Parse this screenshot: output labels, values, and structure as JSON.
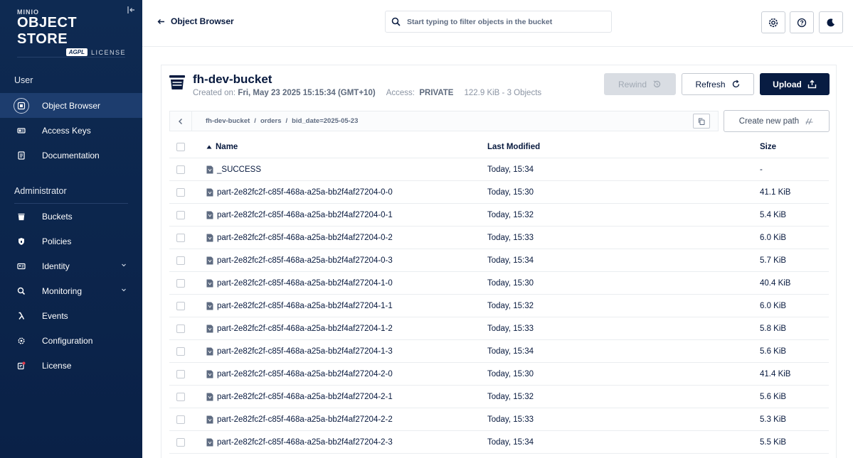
{
  "brand": {
    "minio": "MINIO",
    "title": "OBJECT STORE",
    "agpl": "AGPL",
    "license": "LICENSE"
  },
  "sidebar": {
    "user_section": "User",
    "admin_section": "Administrator",
    "user_items": [
      {
        "label": "Object Browser",
        "icon": "object-browser-icon",
        "active": true
      },
      {
        "label": "Access Keys",
        "icon": "access-keys-icon"
      },
      {
        "label": "Documentation",
        "icon": "documentation-icon"
      }
    ],
    "admin_items": [
      {
        "label": "Buckets",
        "icon": "buckets-icon"
      },
      {
        "label": "Policies",
        "icon": "policies-icon"
      },
      {
        "label": "Identity",
        "icon": "identity-icon",
        "expandable": true
      },
      {
        "label": "Monitoring",
        "icon": "monitoring-icon",
        "expandable": true
      },
      {
        "label": "Events",
        "icon": "lambda-icon"
      },
      {
        "label": "Configuration",
        "icon": "gear-icon"
      },
      {
        "label": "License",
        "icon": "license-icon"
      }
    ]
  },
  "topbar": {
    "back_label": "Object Browser",
    "search_placeholder": "Start typing to filter objects in the bucket"
  },
  "bucket": {
    "name": "fh-dev-bucket",
    "created_label": "Created on:",
    "created_value": "Fri, May 23 2025 15:15:34 (GMT+10)",
    "access_label": "Access:",
    "access_value": "PRIVATE",
    "size_summary": "122.9 KiB - 3 Objects"
  },
  "actions": {
    "rewind": "Rewind",
    "refresh": "Refresh",
    "upload": "Upload",
    "create_path": "Create new path"
  },
  "breadcrumb": [
    "fh-dev-bucket",
    "orders",
    "bid_date=2025-05-23"
  ],
  "table": {
    "headers": {
      "name": "Name",
      "modified": "Last Modified",
      "size": "Size"
    },
    "rows": [
      {
        "name": "_SUCCESS",
        "modified": "Today, 15:34",
        "size": "-"
      },
      {
        "name": "part-2e82fc2f-c85f-468a-a25a-bb2f4af27204-0-0",
        "modified": "Today, 15:30",
        "size": "41.1 KiB"
      },
      {
        "name": "part-2e82fc2f-c85f-468a-a25a-bb2f4af27204-0-1",
        "modified": "Today, 15:32",
        "size": "5.4 KiB"
      },
      {
        "name": "part-2e82fc2f-c85f-468a-a25a-bb2f4af27204-0-2",
        "modified": "Today, 15:33",
        "size": "6.0 KiB"
      },
      {
        "name": "part-2e82fc2f-c85f-468a-a25a-bb2f4af27204-0-3",
        "modified": "Today, 15:34",
        "size": "5.7 KiB"
      },
      {
        "name": "part-2e82fc2f-c85f-468a-a25a-bb2f4af27204-1-0",
        "modified": "Today, 15:30",
        "size": "40.4 KiB"
      },
      {
        "name": "part-2e82fc2f-c85f-468a-a25a-bb2f4af27204-1-1",
        "modified": "Today, 15:32",
        "size": "6.0 KiB"
      },
      {
        "name": "part-2e82fc2f-c85f-468a-a25a-bb2f4af27204-1-2",
        "modified": "Today, 15:33",
        "size": "5.8 KiB"
      },
      {
        "name": "part-2e82fc2f-c85f-468a-a25a-bb2f4af27204-1-3",
        "modified": "Today, 15:34",
        "size": "5.6 KiB"
      },
      {
        "name": "part-2e82fc2f-c85f-468a-a25a-bb2f4af27204-2-0",
        "modified": "Today, 15:30",
        "size": "41.4 KiB"
      },
      {
        "name": "part-2e82fc2f-c85f-468a-a25a-bb2f4af27204-2-1",
        "modified": "Today, 15:32",
        "size": "5.6 KiB"
      },
      {
        "name": "part-2e82fc2f-c85f-468a-a25a-bb2f4af27204-2-2",
        "modified": "Today, 15:33",
        "size": "5.3 KiB"
      },
      {
        "name": "part-2e82fc2f-c85f-468a-a25a-bb2f4af27204-2-3",
        "modified": "Today, 15:34",
        "size": "5.5 KiB"
      }
    ]
  },
  "colors": {
    "sidebar_bg": "#0e2a52",
    "active_item_bg": "#1d3d6e",
    "primary_button": "#081c42",
    "license_badge": "#e23a4c"
  }
}
